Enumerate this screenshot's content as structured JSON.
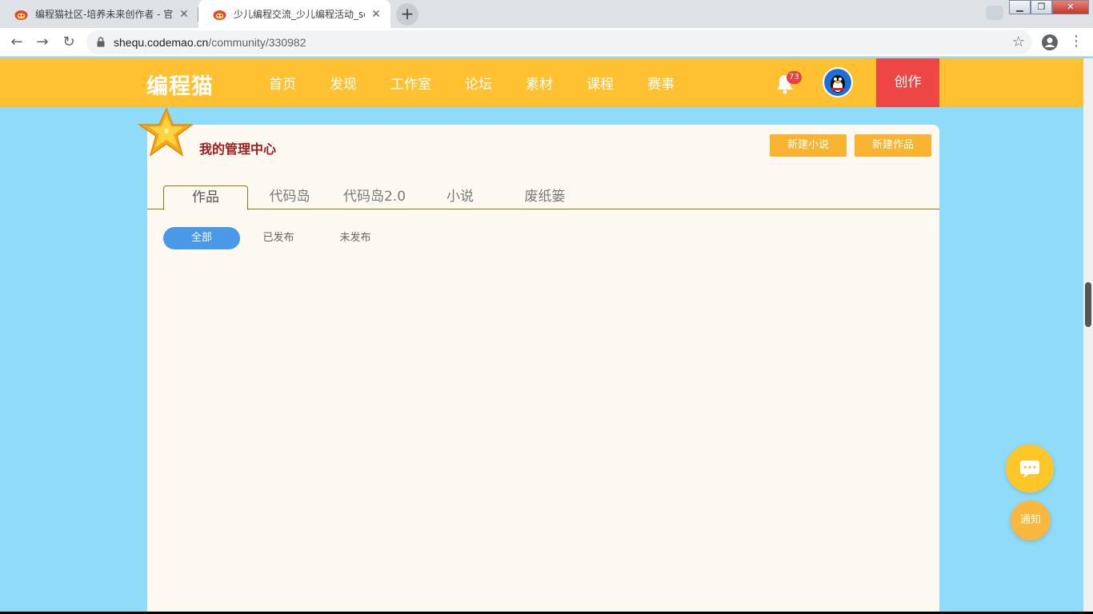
{
  "browser": {
    "tabs": [
      {
        "title": "编程猫社区-培养未来创作者 - 官",
        "active": false
      },
      {
        "title": "少儿编程交流_少儿编程活动_scra",
        "active": true
      }
    ],
    "new_tab_icon": "+",
    "url_host": "shequ.codemao.cn",
    "url_path": "/community/330982"
  },
  "site": {
    "logo": "编程猫",
    "nav": [
      "首页",
      "发现",
      "工作室",
      "论坛",
      "素材",
      "课程",
      "赛事"
    ],
    "notification_count": "73",
    "create_label": "创作",
    "brand_color": "#ffc131",
    "create_color": "#ee4545"
  },
  "panel": {
    "title": "我的管理中心",
    "new_novel": "新建小说",
    "new_work": "新建作品",
    "tabs": [
      "作品",
      "代码岛",
      "代码岛2.0",
      "小说",
      "废纸篓"
    ],
    "active_tab": "作品",
    "subtabs": [
      "全部",
      "已发布",
      "未发布"
    ],
    "active_subtab": "全部"
  },
  "floating": {
    "notify_label": "通知"
  }
}
